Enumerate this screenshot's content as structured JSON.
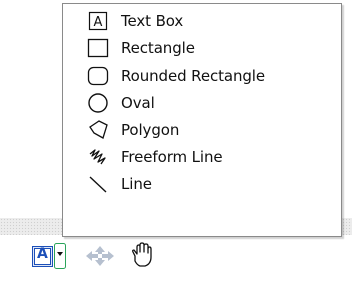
{
  "menu": {
    "items": [
      {
        "label": "Text Box",
        "icon": "text-box-icon"
      },
      {
        "label": "Rectangle",
        "icon": "rectangle-icon"
      },
      {
        "label": "Rounded Rectangle",
        "icon": "rounded-rectangle-icon"
      },
      {
        "label": "Oval",
        "icon": "oval-icon"
      },
      {
        "label": "Polygon",
        "icon": "polygon-icon"
      },
      {
        "label": "Freeform Line",
        "icon": "freeform-line-icon"
      },
      {
        "label": "Line",
        "icon": "line-icon"
      }
    ]
  },
  "toolbar": {
    "text_box_letter": "A",
    "buttons": [
      {
        "icon": "text-box-tool-icon"
      },
      {
        "icon": "dropdown-arrow-icon"
      },
      {
        "icon": "move-arrows-icon"
      },
      {
        "icon": "hand-pan-icon"
      }
    ]
  },
  "colors": {
    "accent_blue": "#1c4fb8",
    "dropdown_green": "#2aa35a",
    "menu_border": "#8a8a8a"
  }
}
